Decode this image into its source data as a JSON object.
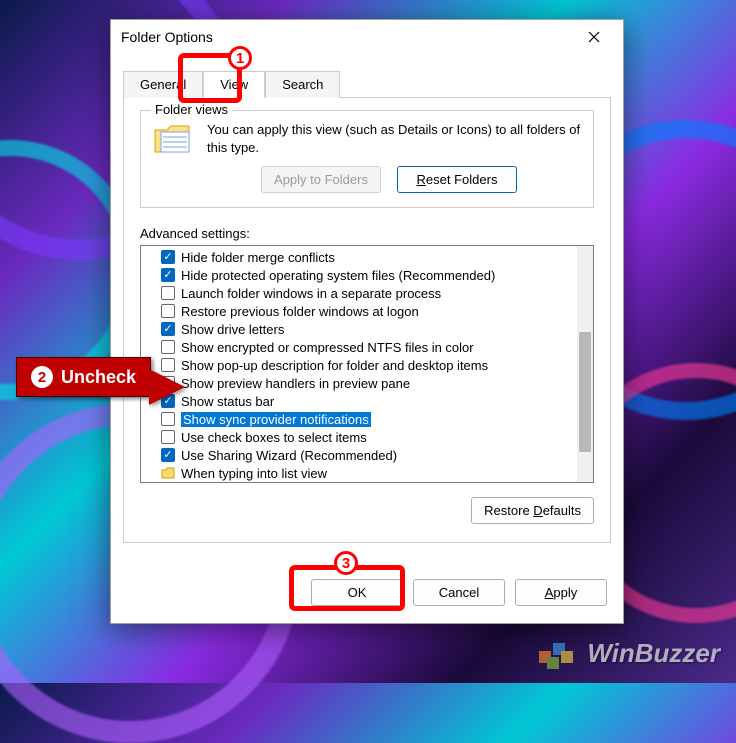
{
  "dialog": {
    "title": "Folder Options"
  },
  "tabs": {
    "general": "General",
    "view": "View",
    "search": "Search"
  },
  "folder_views": {
    "legend": "Folder views",
    "description": "You can apply this view (such as Details or Icons) to all folders of this type.",
    "apply_btn": "Apply to Folders",
    "reset_btn_prefix": "R",
    "reset_btn_rest": "eset Folders"
  },
  "advanced": {
    "label": "Advanced settings:",
    "items": [
      {
        "checked": true,
        "label": "Hide folder merge conflicts"
      },
      {
        "checked": true,
        "label": "Hide protected operating system files (Recommended)"
      },
      {
        "checked": false,
        "label": "Launch folder windows in a separate process"
      },
      {
        "checked": false,
        "label": "Restore previous folder windows at logon"
      },
      {
        "checked": true,
        "label": "Show drive letters"
      },
      {
        "checked": false,
        "label": "Show encrypted or compressed NTFS files in color"
      },
      {
        "checked": false,
        "label": "Show pop-up description for folder and desktop items"
      },
      {
        "checked": false,
        "label": "Show preview handlers in preview pane"
      },
      {
        "checked": true,
        "label": "Show status bar"
      },
      {
        "checked": false,
        "label": "Show sync provider notifications",
        "selected": true
      },
      {
        "checked": false,
        "label": "Use check boxes to select items"
      },
      {
        "checked": true,
        "label": "Use Sharing Wizard (Recommended)"
      },
      {
        "folder": true,
        "label": "When typing into list view"
      }
    ]
  },
  "buttons": {
    "restore_prefix": "Restore ",
    "restore_ul": "D",
    "restore_rest": "efaults",
    "ok": "OK",
    "cancel": "Cancel",
    "apply_ul": "A",
    "apply_rest": "pply"
  },
  "annotations": {
    "n1": "1",
    "n2": "2",
    "n2_label": "Uncheck",
    "n3": "3"
  },
  "watermark": "WinBuzzer"
}
